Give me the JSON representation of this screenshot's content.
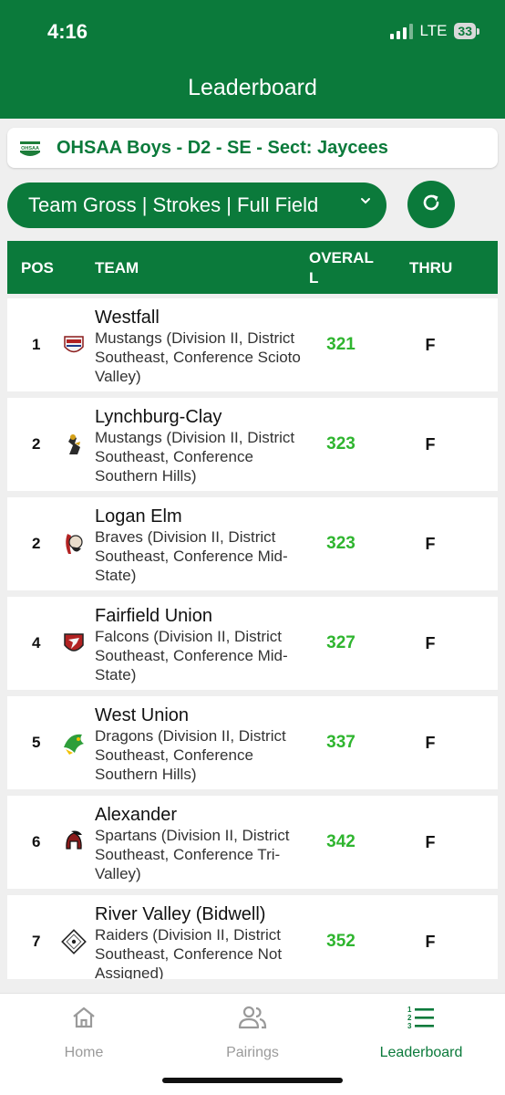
{
  "status": {
    "time": "4:16",
    "network": "LTE",
    "battery": "33"
  },
  "nav": {
    "title": "Leaderboard"
  },
  "event": {
    "logo_text": "OHSAA",
    "title": "OHSAA Boys - D2 - SE - Sect: Jaycees"
  },
  "filter": {
    "label": "Team Gross | Strokes | Full Field"
  },
  "table": {
    "headers": {
      "pos": "POS",
      "team": "TEAM",
      "overall": "OVERALL",
      "thru": "THRU"
    },
    "rows": [
      {
        "pos": "1",
        "name": "Westfall",
        "desc": "Mustangs (Division II, District Southeast, Conference Scioto Valley)",
        "score": "321",
        "thru": "F",
        "logo": "westfall-logo-icon"
      },
      {
        "pos": "2",
        "name": "Lynchburg-Clay",
        "desc": "Mustangs (Division II, District Southeast, Conference Southern Hills)",
        "score": "323",
        "thru": "F",
        "logo": "lynchburg-clay-logo-icon"
      },
      {
        "pos": "2",
        "name": "Logan Elm",
        "desc": "Braves (Division II, District Southeast, Conference Mid-State)",
        "score": "323",
        "thru": "F",
        "logo": "logan-elm-logo-icon"
      },
      {
        "pos": "4",
        "name": "Fairfield Union",
        "desc": "Falcons (Division II, District Southeast, Conference Mid-State)",
        "score": "327",
        "thru": "F",
        "logo": "fairfield-union-logo-icon"
      },
      {
        "pos": "5",
        "name": "West Union",
        "desc": "Dragons (Division II, District Southeast, Conference Southern Hills)",
        "score": "337",
        "thru": "F",
        "logo": "west-union-logo-icon"
      },
      {
        "pos": "6",
        "name": "Alexander",
        "desc": "Spartans (Division II, District Southeast, Conference Tri-Valley)",
        "score": "342",
        "thru": "F",
        "logo": "alexander-logo-icon"
      },
      {
        "pos": "7",
        "name": "River Valley (Bidwell)",
        "desc": "Raiders (Division II, District Southeast, Conference Not Assigned)",
        "score": "352",
        "thru": "F",
        "logo": "river-valley-logo-icon"
      }
    ]
  },
  "tabs": [
    {
      "label": "Home",
      "icon": "home-icon",
      "active": false
    },
    {
      "label": "Pairings",
      "icon": "people-icon",
      "active": false
    },
    {
      "label": "Leaderboard",
      "icon": "leaderboard-icon",
      "active": true
    }
  ],
  "colors": {
    "brand": "#0b7a3b",
    "score": "#2fb52f",
    "inactive": "#9a9a9a"
  }
}
